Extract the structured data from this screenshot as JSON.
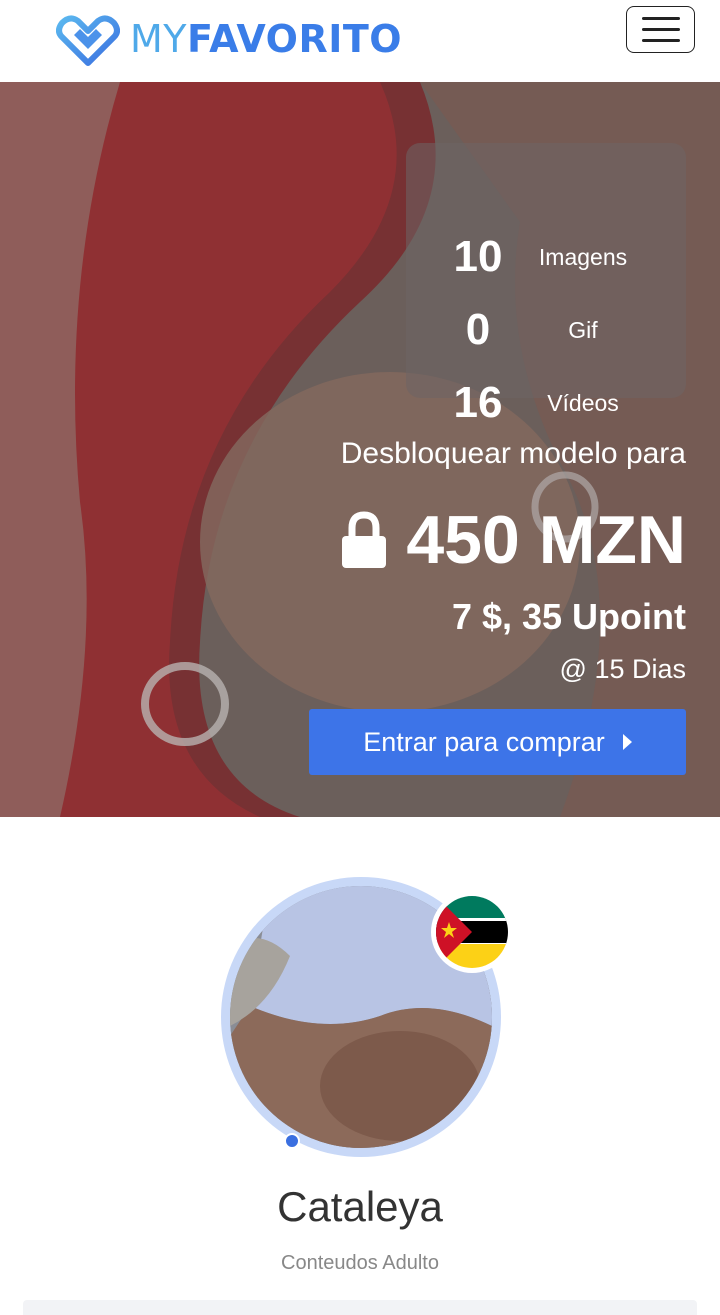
{
  "header": {
    "logo_my": "MY",
    "logo_favorito": "FAVORITO",
    "menu_icon": "hamburger-icon"
  },
  "hero": {
    "stats": [
      {
        "value": "10",
        "label": "Imagens"
      },
      {
        "value": "0",
        "label": "Gif"
      },
      {
        "value": "16",
        "label": "Vídeos"
      }
    ],
    "unlock_text": "Desbloquear modelo para",
    "lock_icon": "lock-icon",
    "price": "450 MZN",
    "upoint": "7 $, 35 Upoint",
    "duration": "@ 15 Dias",
    "buy_button": "Entrar para comprar",
    "buy_button_icon": "caret-right-icon"
  },
  "profile": {
    "name": "Cataleya",
    "subtitle": "Conteudos Adulto",
    "flag_icon": "mozambique-flag-icon",
    "online": true
  },
  "colors": {
    "brand_blue": "#3a7de8",
    "button_blue": "#3d74e8",
    "avatar_ring": "#c8d8f7"
  }
}
